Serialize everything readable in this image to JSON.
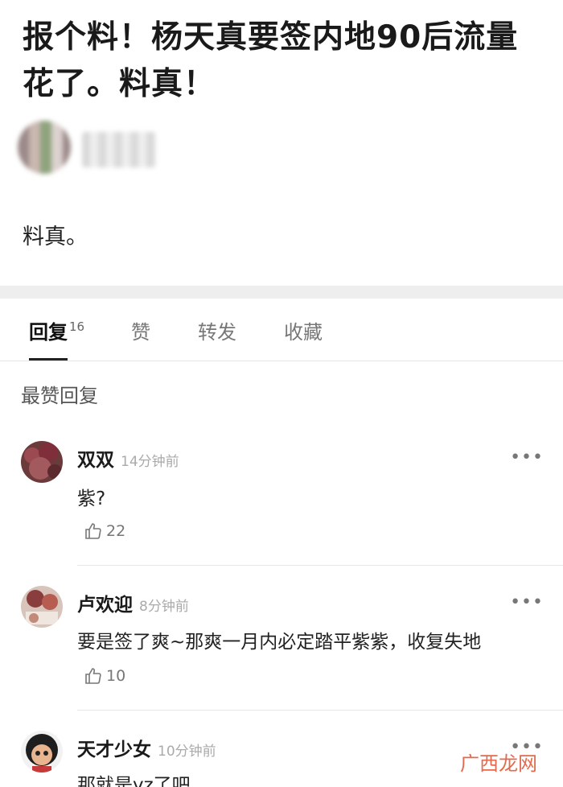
{
  "post": {
    "title": "报个料！杨天真要签内地90后流量花了。料真！",
    "body": "料真。"
  },
  "tabs": [
    {
      "label": "回复",
      "count": "16"
    },
    {
      "label": "赞"
    },
    {
      "label": "转发"
    },
    {
      "label": "收藏"
    }
  ],
  "section_label": "最赞回复",
  "comments": [
    {
      "name": "双双",
      "time": "14分钟前",
      "text": "紫?",
      "likes": "22",
      "more": "•••"
    },
    {
      "name": "卢欢迎",
      "time": "8分钟前",
      "text": "要是签了爽~那爽一月内必定踏平紫紫，收复失地",
      "likes": "10",
      "more": "•••"
    },
    {
      "name": "天才少女",
      "time": "10分钟前",
      "text": "那就是yz了吧",
      "more": "•••"
    }
  ],
  "watermark": "广西龙网"
}
